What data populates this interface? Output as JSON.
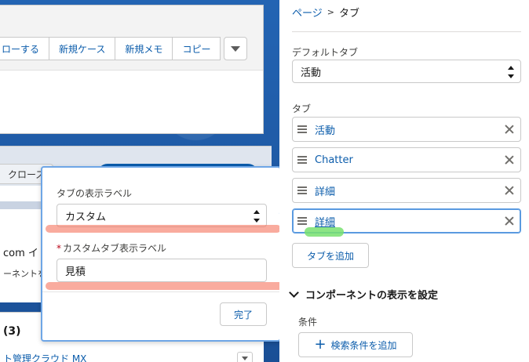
{
  "canvas": {
    "action_buttons": [
      "ローする",
      "新規ケース",
      "新規メモ",
      "コピー"
    ],
    "closed_label": "クローズ",
    "partial_text": "com イ",
    "component_text": "ーネントを",
    "related_count": "(3)",
    "related_link": "ト管理クラウド MX"
  },
  "popover": {
    "tab_label_field": "タブの表示ラベル",
    "tab_label_value": "カスタム",
    "custom_label_required": "*",
    "custom_label_field": "カスタムタブ表示ラベル",
    "custom_label_value": "見積",
    "done_button": "完了"
  },
  "panel": {
    "breadcrumb": {
      "parent": "ページ",
      "separator": ">",
      "current": "タブ"
    },
    "default_tab_label": "デフォルトタブ",
    "default_tab_value": "活動",
    "tabs_label": "タブ",
    "tabs": [
      {
        "name": "活動"
      },
      {
        "name": "Chatter"
      },
      {
        "name": "詳細"
      },
      {
        "name": "詳細"
      }
    ],
    "add_tab_button": "タブを追加",
    "component_visibility": "コンポーネントの表示を設定",
    "conditions_label": "条件",
    "add_filter_button": "検索条件を追加"
  },
  "colors": {
    "canvas_bg": "#1f5aa6",
    "link": "#0b5cab",
    "highlight_red": "#f67862",
    "highlight_green": "#78e06e",
    "active_border": "#5a9ae0"
  }
}
